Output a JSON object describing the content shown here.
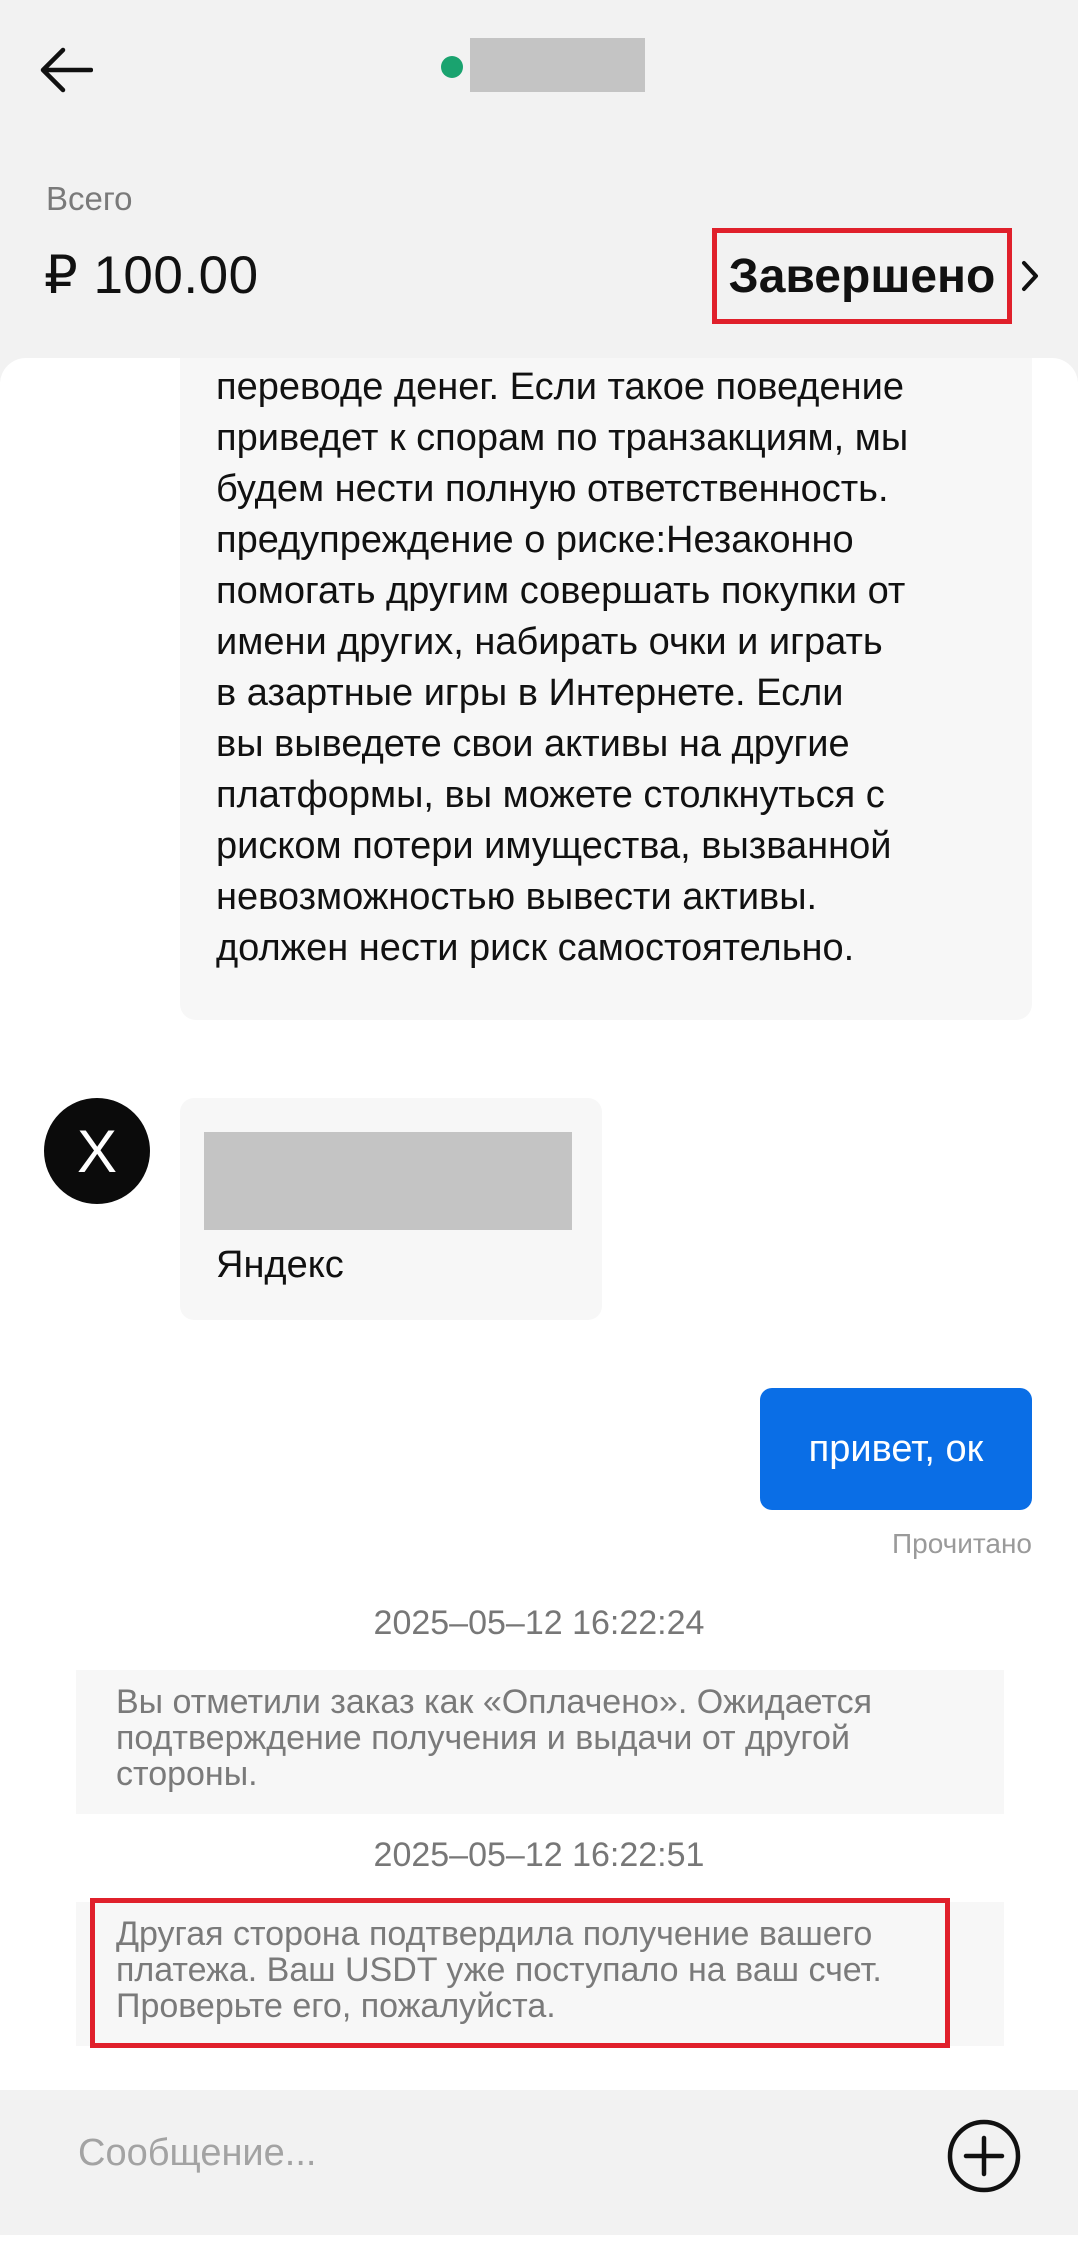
{
  "header": {
    "back_icon": "arrow-left-icon",
    "status_dot_color": "#1aa36f",
    "name_redacted": true
  },
  "summary": {
    "total_label": "Всего",
    "total_amount": "₽ 100.00",
    "status_text": "Завершено",
    "status_chevron_icon": "chevron-right-icon",
    "status_highlight_color": "#e0202b"
  },
  "chat": {
    "long_message": "переводе денег. Если такое поведение\nприведет к спорам по транзакциям, мы\nбудем нести полную ответственность.\nпредупреждение о риске:Незаконно\nпомогать другим совершать покупки от\nимени других, набирать очки и играть\nв азартные игры в Интернете. Если\nвы выведете свои активы на другие\nплатформы, вы можете столкнуться с\nриском потери имущества, вызванной\nневозможностью вывести активы.\nдолжен нести риск самостоятельно.",
    "avatar_letter": "X",
    "card_title": "Яндекс",
    "sent_message": "привет, ок",
    "sent_color": "#0a6ee6",
    "read_status": "Прочитано",
    "timestamp_1": "2025–05–12 16:22:24",
    "system_message_1": "Вы отметили заказ как «Оплачено». Ожидается подтверждение получения и выдачи от другой стороны.",
    "timestamp_2": "2025–05–12 16:22:51",
    "system_message_2": "Другая сторона подтвердила получение вашего платежа. Ваш USDT уже поступало на ваш счет. Проверьте его, пожалуйста."
  },
  "composer": {
    "placeholder": "Сообщение...",
    "add_icon": "plus-circle-icon"
  }
}
